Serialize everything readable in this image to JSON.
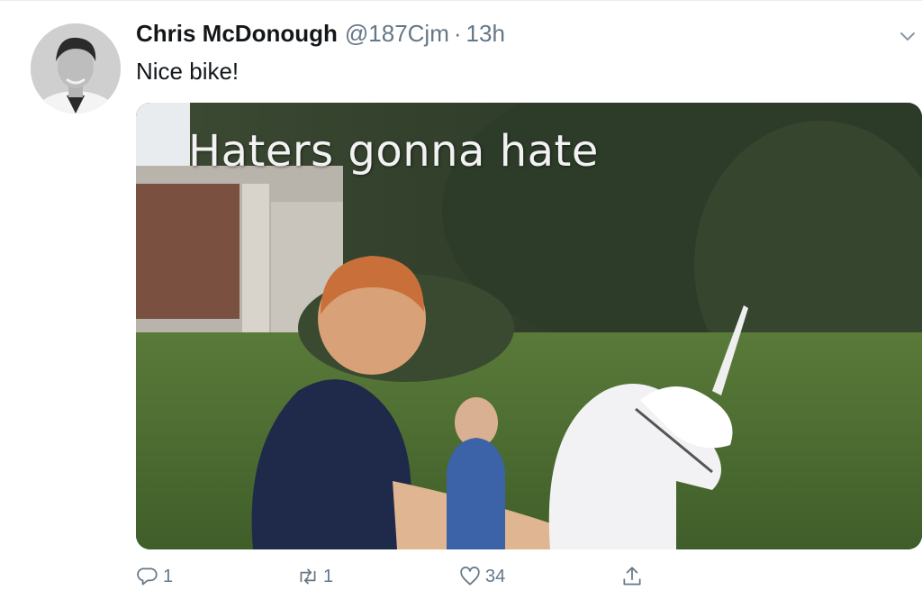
{
  "tweet": {
    "author_name": "Chris McDonough",
    "handle": "@187Cjm",
    "separator": "·",
    "time": "13h",
    "text": "Nice bike!",
    "media_caption": "Haters gonna hate"
  },
  "actions": {
    "reply_count": "1",
    "retweet_count": "1",
    "like_count": "34"
  },
  "icons": {
    "more": "chevron-down-icon",
    "reply": "reply-icon",
    "retweet": "retweet-icon",
    "like": "heart-icon",
    "share": "share-icon"
  },
  "colors": {
    "text": "#14171a",
    "muted": "#657786",
    "divider": "#e6ecf0"
  }
}
